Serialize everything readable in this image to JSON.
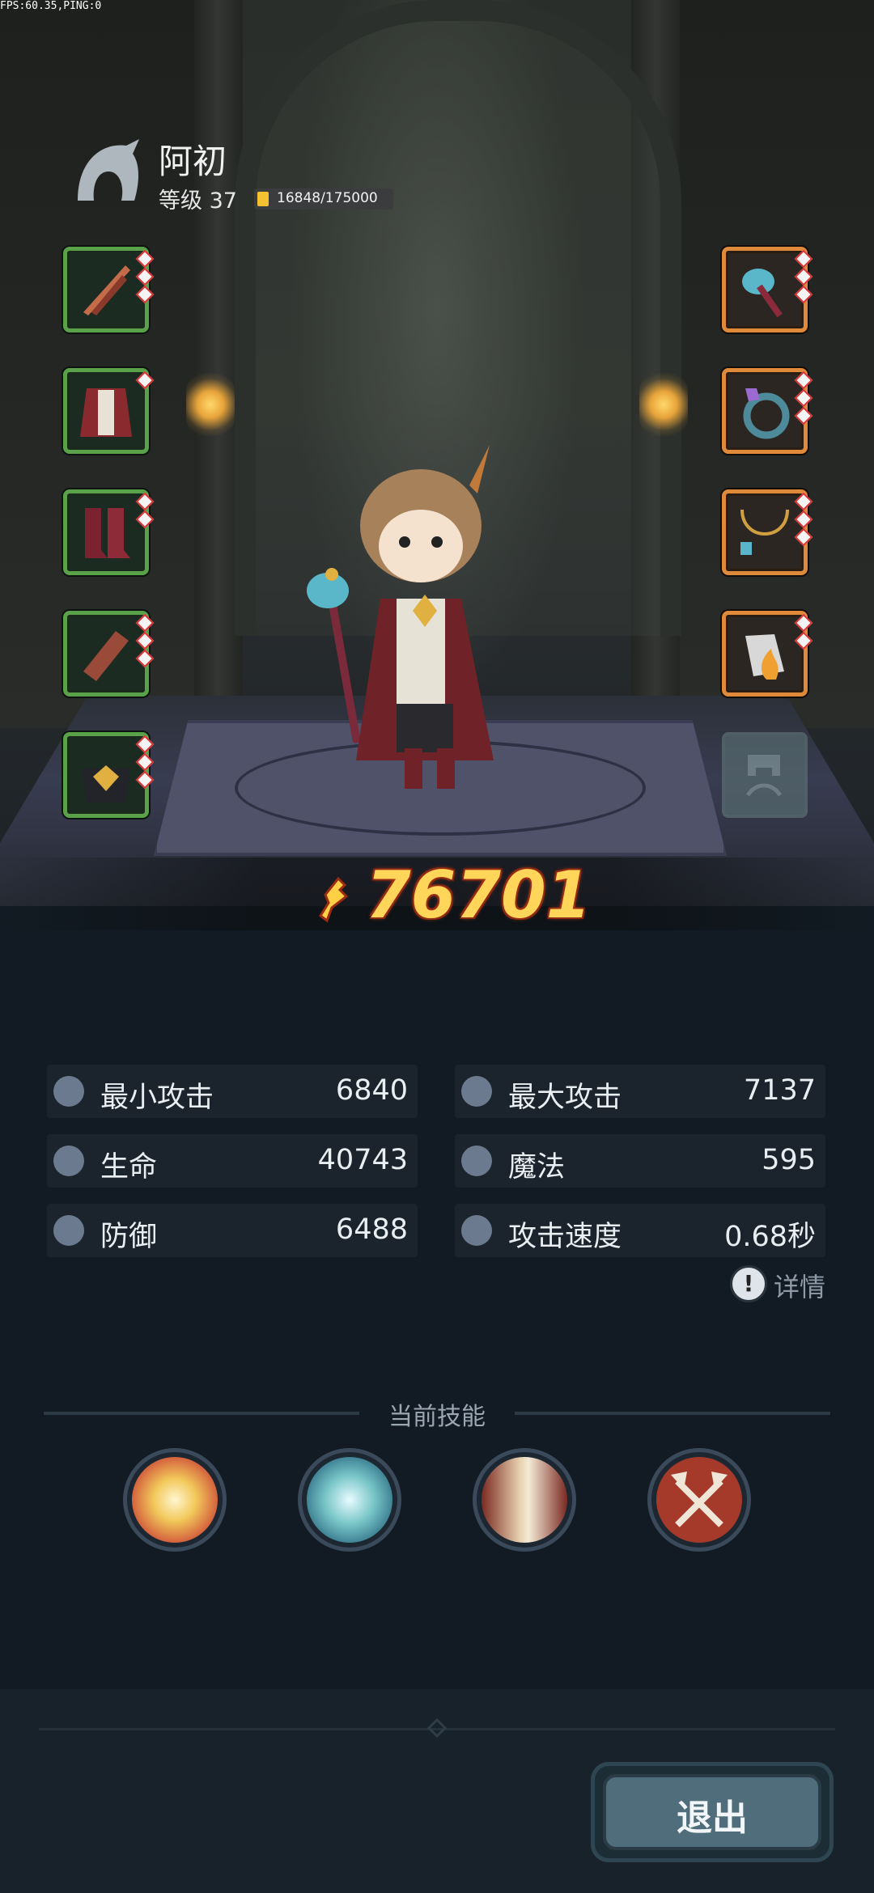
{
  "debug": {
    "fps_text": "FPS:60.35,PING:0"
  },
  "hero": {
    "name": "阿初",
    "level_text": "等级 37",
    "xp_text": "16848/175000",
    "xp_progress": 0.0963
  },
  "equipment": {
    "left": [
      "weapon-arrows",
      "armor-coat",
      "boots",
      "bracer",
      "helmet"
    ],
    "right": [
      "staff",
      "ring",
      "necklace",
      "talisman",
      "empty"
    ]
  },
  "power": {
    "value": "76701"
  },
  "stats": [
    {
      "icon": "sword-icon",
      "label": "最小攻击",
      "value": "6840"
    },
    {
      "icon": "sword-icon",
      "label": "最大攻击",
      "value": "7137"
    },
    {
      "icon": "heart-icon",
      "label": "生命",
      "value": "40743"
    },
    {
      "icon": "magic-icon",
      "label": "魔法",
      "value": "595"
    },
    {
      "icon": "shield-icon",
      "label": "防御",
      "value": "6488"
    },
    {
      "icon": "speed-icon",
      "label": "攻击速度",
      "value": "0.68秒"
    }
  ],
  "details": {
    "icon": "exclamation-icon",
    "label": "详情"
  },
  "skills": {
    "title": "当前技能",
    "items": [
      {
        "icon": "explosion-icon",
        "color": "#f2c85a"
      },
      {
        "icon": "ice-burst-icon",
        "color": "#79c6c8"
      },
      {
        "icon": "flame-pillar-icon",
        "color": "#e8d2b0"
      },
      {
        "icon": "crossed-axes-icon",
        "color": "#a53a2a"
      }
    ]
  },
  "exit_button": {
    "label": "退出"
  },
  "colors": {
    "accent_green": "#5aa24a",
    "accent_orange": "#df8a3a",
    "power_gold": "#ffd55a"
  }
}
